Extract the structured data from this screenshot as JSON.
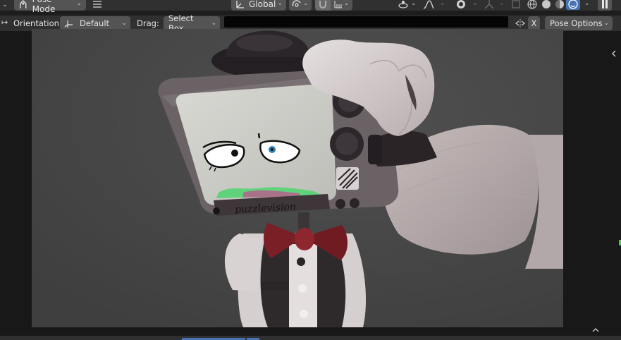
{
  "header": {
    "mode_label": "Pose Mode",
    "transform_orientation": "Global"
  },
  "toolbar": {
    "orientation_label": "Orientation:",
    "orientation_value": "Default",
    "drag_label": "Drag:",
    "drag_value": "Select Box",
    "x_label": "X",
    "pose_options_label": "Pose Options"
  },
  "render": {
    "screen_text": "puzzlevision"
  },
  "icons": [
    "mode-icon",
    "hamburger-menu-icon",
    "transform-orientation-icon",
    "pivot-icon",
    "snap-icon",
    "snap-increment-icon",
    "proportional-edit-icon",
    "falloff-icon",
    "visibility-icon",
    "gizmo-icon",
    "overlay-icon",
    "xray-icon",
    "wireframe-shading-icon",
    "solid-shading-icon",
    "material-shading-icon",
    "rendered-shading-icon",
    "pause-icon",
    "orientation-axes-icon",
    "sidebar-toggle-icon"
  ],
  "colors": {
    "header_bg": "#303030",
    "button_bg": "#545454",
    "active_blue": "#4772b3",
    "camera_bg": "#474747"
  }
}
